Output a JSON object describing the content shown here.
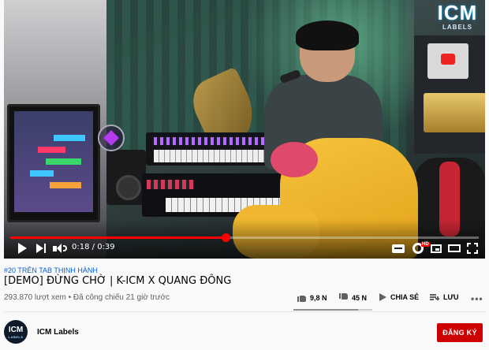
{
  "player": {
    "current_time": "0:18",
    "duration": "0:39",
    "time_separator": " / ",
    "progress_fraction": 0.46,
    "watermark_logo": {
      "big": "ICM",
      "small": "LABELS"
    }
  },
  "video": {
    "hashtag": "#20 TRÊN TAB THỊNH HÀNH",
    "title": "[DEMO] ĐỪNG CHỜ | K-ICM X QUANG ĐÔNG",
    "views": "293.870 lượt xem",
    "separator": " • ",
    "published": "Đã công chiếu 21 giờ trước"
  },
  "actions": {
    "like_count": "9,8 N",
    "dislike_count": "45 N",
    "share_label": "CHIA SẺ",
    "save_label": "LƯU",
    "more_label": "•••",
    "like_ratio": 0.18
  },
  "channel": {
    "name": "ICM Labels",
    "avatar_big": "ICM",
    "avatar_small": "LABELS",
    "subscribe_label": "ĐĂNG KÝ"
  },
  "colors": {
    "accent_red": "#ff0000",
    "subscribe_red": "#cc0000",
    "link_blue": "#065fd4"
  },
  "icons": [
    "play-icon",
    "next-icon",
    "volume-icon",
    "captions-icon",
    "settings-icon",
    "miniplayer-icon",
    "theater-icon",
    "fullscreen-icon",
    "like-icon",
    "dislike-icon",
    "share-icon",
    "save-icon"
  ]
}
